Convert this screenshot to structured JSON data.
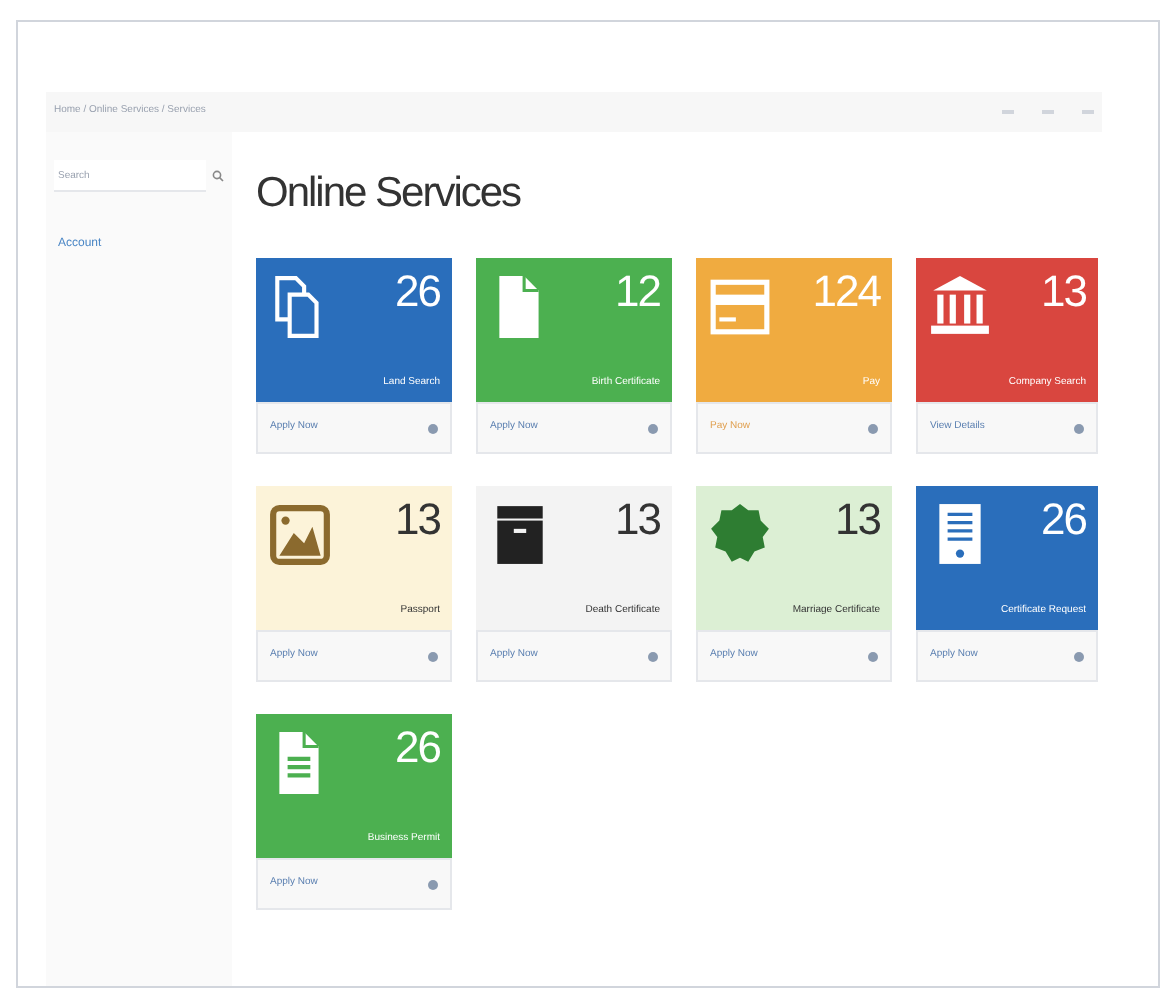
{
  "topbar": {
    "breadcrumb": "Home / Online Services / Services"
  },
  "sidebar": {
    "search": {
      "placeholder": "Search"
    },
    "items": [
      {
        "label": "Account",
        "selected": false
      }
    ]
  },
  "title": "Online Services",
  "cards": [
    {
      "kind": "copies",
      "color": "#2a6ebb",
      "count": "26",
      "label": "Land Search",
      "footer": "Apply Now"
    },
    {
      "kind": "file",
      "color": "#4cb050",
      "count": "12",
      "label": "Birth Certificate",
      "footer": "Apply Now"
    },
    {
      "kind": "card",
      "color": "#f0ab40",
      "count": "124",
      "label": "Pay",
      "footer": "Pay Now"
    },
    {
      "kind": "bank",
      "color": "#d9463f",
      "count": "13",
      "label": "Company Search",
      "footer": "View Details"
    },
    {
      "kind": "image",
      "color": "#fcf3d9",
      "count": "13",
      "label": "Passport",
      "footer": "Apply Now"
    },
    {
      "kind": "box",
      "color": "#f3f3f3",
      "count": "13",
      "label": "Death Certificate",
      "footer": "Apply Now"
    },
    {
      "kind": "seal",
      "color": "#dcefd4",
      "count": "13",
      "label": "Marriage Certificate",
      "footer": "Apply Now"
    },
    {
      "kind": "list",
      "color": "#2a6ebb",
      "count": "26",
      "label": "Certificate Request",
      "footer": "Apply Now"
    },
    {
      "kind": "doc",
      "color": "#4cb050",
      "count": "26",
      "label": "Business Permit",
      "footer": "Apply Now"
    }
  ]
}
